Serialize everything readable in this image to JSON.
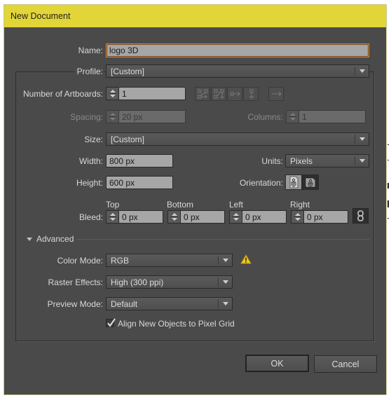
{
  "window": {
    "title": "New Document"
  },
  "name": {
    "label": "Name:",
    "value": "logo 3D"
  },
  "profile": {
    "label": "Profile:",
    "value": "[Custom]"
  },
  "artboards": {
    "label": "Number of Artboards:",
    "value": "1",
    "layout_icons": [
      "grid-by-row-icon",
      "grid-by-column-icon",
      "arrange-by-row-icon",
      "arrange-by-column-icon"
    ],
    "direction_icon": "right-to-left-layout-icon"
  },
  "spacing": {
    "label": "Spacing:",
    "value": "20 px",
    "enabled": false
  },
  "columns": {
    "label": "Columns:",
    "value": "1",
    "enabled": false
  },
  "size": {
    "label": "Size:",
    "value": "[Custom]"
  },
  "width": {
    "label": "Width:",
    "value": "800 px"
  },
  "height": {
    "label": "Height:",
    "value": "600 px"
  },
  "units": {
    "label": "Units:",
    "value": "Pixels"
  },
  "orientation": {
    "label": "Orientation:",
    "options": [
      "portrait",
      "landscape"
    ],
    "selected": "portrait"
  },
  "bleed": {
    "label": "Bleed:",
    "top": {
      "label": "Top",
      "value": "0 px"
    },
    "bottom": {
      "label": "Bottom",
      "value": "0 px"
    },
    "left": {
      "label": "Left",
      "value": "0 px"
    },
    "right": {
      "label": "Right",
      "value": "0 px"
    },
    "link_icon": "chain-link-icon"
  },
  "advanced": {
    "label": "Advanced",
    "expanded": true,
    "color_mode": {
      "label": "Color Mode:",
      "value": "RGB",
      "warning_icon": "warning-icon"
    },
    "raster_effects": {
      "label": "Raster Effects:",
      "value": "High (300 ppi)"
    },
    "preview_mode": {
      "label": "Preview Mode:",
      "value": "Default"
    },
    "align_pixel_grid": {
      "label": "Align New Objects to Pixel Grid",
      "checked": true
    }
  },
  "buttons": {
    "ok": "OK",
    "cancel": "Cancel"
  },
  "colors": {
    "titlebar": "#e2d537",
    "dialog_bg": "#4a4a4a",
    "focus_border": "#d3883a",
    "warning": "#f0c419"
  }
}
